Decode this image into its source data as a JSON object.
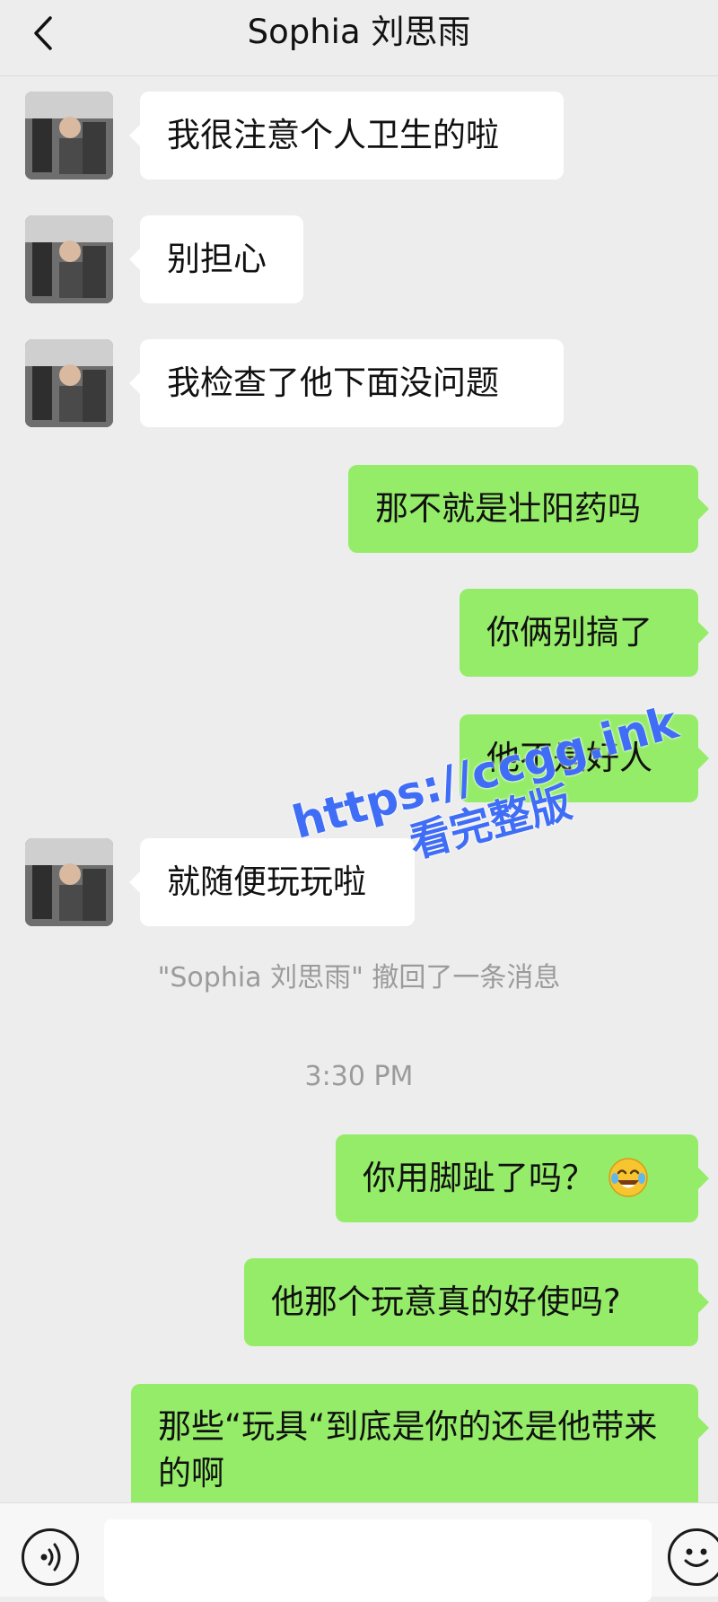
{
  "header": {
    "title": "Sophia 刘思雨"
  },
  "messages": [
    {
      "text": "我很注意个人卫生的啦"
    },
    {
      "text": "别担心"
    },
    {
      "text": "我检查了他下面没问题"
    },
    {
      "text": "那不就是壮阳药吗"
    },
    {
      "text": "你俩别搞了"
    },
    {
      "text": "他不是好人"
    },
    {
      "text": "就随便玩玩啦"
    },
    {
      "text": "你用脚趾了吗？"
    },
    {
      "text": "他那个玩意真的好使吗?"
    },
    {
      "text": "那些“玩具“到底是你的还是他带来的啊"
    }
  ],
  "system_notice": "\"Sophia 刘思雨\" 撤回了一条消息",
  "timestamp": "3:30 PM",
  "watermark": {
    "url": "https://ccgg.ink",
    "text": "看完整版"
  },
  "icons": {
    "back": "chevron-left-icon",
    "voice": "voice-icon",
    "emoji": "smiley-icon",
    "laugh_emoji": "tears-of-joy-emoji"
  },
  "colors": {
    "outgoing_bubble": "#95ec69",
    "incoming_bubble": "#ffffff",
    "background": "#ededed",
    "watermark": "#3f6df6"
  }
}
